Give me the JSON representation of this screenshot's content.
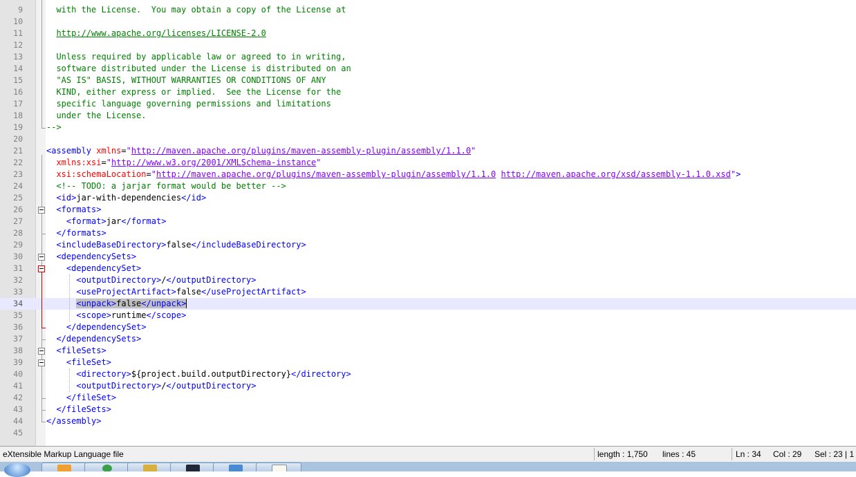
{
  "editor": {
    "current_line": 34,
    "lines": [
      {
        "n": "9",
        "segs": [
          {
            "t": "  with the License.  You may obtain a copy of the License at",
            "c": "cm"
          }
        ]
      },
      {
        "n": "10",
        "segs": []
      },
      {
        "n": "11",
        "segs": [
          {
            "t": "  ",
            "c": "cm"
          },
          {
            "t": "http://www.apache.org/licenses/LICENSE-2.0",
            "c": "cm-link"
          }
        ]
      },
      {
        "n": "12",
        "segs": []
      },
      {
        "n": "13",
        "segs": [
          {
            "t": "  Unless required by applicable law or agreed to in writing,",
            "c": "cm"
          }
        ]
      },
      {
        "n": "14",
        "segs": [
          {
            "t": "  software distributed under the License is distributed on an",
            "c": "cm"
          }
        ]
      },
      {
        "n": "15",
        "segs": [
          {
            "t": "  \"AS IS\" BASIS, WITHOUT WARRANTIES OR CONDITIONS OF ANY",
            "c": "cm"
          }
        ]
      },
      {
        "n": "16",
        "segs": [
          {
            "t": "  KIND, either express or implied.  See the License for the",
            "c": "cm"
          }
        ]
      },
      {
        "n": "17",
        "segs": [
          {
            "t": "  specific language governing permissions and limitations",
            "c": "cm"
          }
        ]
      },
      {
        "n": "18",
        "segs": [
          {
            "t": "  under the License.",
            "c": "cm"
          }
        ]
      },
      {
        "n": "19",
        "segs": [
          {
            "t": "-->",
            "c": "cm"
          }
        ]
      },
      {
        "n": "20",
        "segs": []
      },
      {
        "n": "21",
        "segs": [
          {
            "t": "<assembly ",
            "c": "tag"
          },
          {
            "t": "xmlns",
            "c": "attr"
          },
          {
            "t": "=",
            "c": "txt"
          },
          {
            "t": "\"",
            "c": "str"
          },
          {
            "t": "http://maven.apache.org/plugins/maven-assembly-plugin/assembly/1.1.0",
            "c": "url"
          },
          {
            "t": "\"",
            "c": "str"
          }
        ]
      },
      {
        "n": "22",
        "segs": [
          {
            "t": "  ",
            "c": "txt"
          },
          {
            "t": "xmlns:xsi",
            "c": "attr"
          },
          {
            "t": "=",
            "c": "txt"
          },
          {
            "t": "\"",
            "c": "str"
          },
          {
            "t": "http://www.w3.org/2001/XMLSchema-instance",
            "c": "url"
          },
          {
            "t": "\"",
            "c": "str"
          }
        ]
      },
      {
        "n": "23",
        "segs": [
          {
            "t": "  ",
            "c": "txt"
          },
          {
            "t": "xsi:schemaLocation",
            "c": "attr"
          },
          {
            "t": "=",
            "c": "txt"
          },
          {
            "t": "\"",
            "c": "str"
          },
          {
            "t": "http://maven.apache.org/plugins/maven-assembly-plugin/assembly/1.1.0",
            "c": "url"
          },
          {
            "t": " ",
            "c": "str"
          },
          {
            "t": "http://maven.apache.org/xsd/assembly-1.1.0.xsd",
            "c": "url"
          },
          {
            "t": "\"",
            "c": "str"
          },
          {
            "t": ">",
            "c": "tag"
          }
        ]
      },
      {
        "n": "24",
        "segs": [
          {
            "t": "  <!-- TODO: a jarjar format would be better -->",
            "c": "cm"
          }
        ]
      },
      {
        "n": "25",
        "segs": [
          {
            "t": "  ",
            "c": "txt"
          },
          {
            "t": "<id>",
            "c": "tag"
          },
          {
            "t": "jar-with-dependencies",
            "c": "txt"
          },
          {
            "t": "</id>",
            "c": "tag"
          }
        ]
      },
      {
        "n": "26",
        "segs": [
          {
            "t": "  ",
            "c": "txt"
          },
          {
            "t": "<formats>",
            "c": "tag"
          }
        ]
      },
      {
        "n": "27",
        "segs": [
          {
            "t": "    ",
            "c": "txt"
          },
          {
            "t": "<format>",
            "c": "tag"
          },
          {
            "t": "jar",
            "c": "txt"
          },
          {
            "t": "</format>",
            "c": "tag"
          }
        ]
      },
      {
        "n": "28",
        "segs": [
          {
            "t": "  ",
            "c": "txt"
          },
          {
            "t": "</formats>",
            "c": "tag"
          }
        ]
      },
      {
        "n": "29",
        "segs": [
          {
            "t": "  ",
            "c": "txt"
          },
          {
            "t": "<includeBaseDirectory>",
            "c": "tag"
          },
          {
            "t": "false",
            "c": "txt"
          },
          {
            "t": "</includeBaseDirectory>",
            "c": "tag"
          }
        ]
      },
      {
        "n": "30",
        "segs": [
          {
            "t": "  ",
            "c": "txt"
          },
          {
            "t": "<dependencySets>",
            "c": "tag"
          }
        ]
      },
      {
        "n": "31",
        "segs": [
          {
            "t": "    ",
            "c": "txt"
          },
          {
            "t": "<dependencySet>",
            "c": "tag"
          }
        ]
      },
      {
        "n": "32",
        "segs": [
          {
            "t": "      ",
            "c": "txt"
          },
          {
            "t": "<outputDirectory>",
            "c": "tag"
          },
          {
            "t": "/",
            "c": "txt"
          },
          {
            "t": "</outputDirectory>",
            "c": "tag"
          }
        ]
      },
      {
        "n": "33",
        "segs": [
          {
            "t": "      ",
            "c": "txt"
          },
          {
            "t": "<useProjectArtifact>",
            "c": "tag"
          },
          {
            "t": "false",
            "c": "txt"
          },
          {
            "t": "</useProjectArtifact>",
            "c": "tag"
          }
        ]
      },
      {
        "n": "34",
        "segs": [
          {
            "t": "      ",
            "c": "txt"
          },
          {
            "t": "<unpack>",
            "c": "tag hl"
          },
          {
            "t": "false",
            "c": "txt hl"
          },
          {
            "t": "</unpack>",
            "c": "tag hl caret"
          }
        ]
      },
      {
        "n": "35",
        "segs": [
          {
            "t": "      ",
            "c": "txt"
          },
          {
            "t": "<scope>",
            "c": "tag"
          },
          {
            "t": "runtime",
            "c": "txt"
          },
          {
            "t": "</scope>",
            "c": "tag"
          }
        ]
      },
      {
        "n": "36",
        "segs": [
          {
            "t": "    ",
            "c": "txt"
          },
          {
            "t": "</dependencySet>",
            "c": "tag"
          }
        ]
      },
      {
        "n": "37",
        "segs": [
          {
            "t": "  ",
            "c": "txt"
          },
          {
            "t": "</dependencySets>",
            "c": "tag"
          }
        ]
      },
      {
        "n": "38",
        "segs": [
          {
            "t": "  ",
            "c": "txt"
          },
          {
            "t": "<fileSets>",
            "c": "tag"
          }
        ]
      },
      {
        "n": "39",
        "segs": [
          {
            "t": "    ",
            "c": "txt"
          },
          {
            "t": "<fileSet>",
            "c": "tag"
          }
        ]
      },
      {
        "n": "40",
        "segs": [
          {
            "t": "      ",
            "c": "txt"
          },
          {
            "t": "<directory>",
            "c": "tag"
          },
          {
            "t": "${project.build.outputDirectory}",
            "c": "txt"
          },
          {
            "t": "</directory>",
            "c": "tag"
          }
        ]
      },
      {
        "n": "41",
        "segs": [
          {
            "t": "      ",
            "c": "txt"
          },
          {
            "t": "<outputDirectory>",
            "c": "tag"
          },
          {
            "t": "/",
            "c": "txt"
          },
          {
            "t": "</outputDirectory>",
            "c": "tag"
          }
        ]
      },
      {
        "n": "42",
        "segs": [
          {
            "t": "    ",
            "c": "txt"
          },
          {
            "t": "</fileSet>",
            "c": "tag"
          }
        ]
      },
      {
        "n": "43",
        "segs": [
          {
            "t": "  ",
            "c": "txt"
          },
          {
            "t": "</fileSets>",
            "c": "tag"
          }
        ]
      },
      {
        "n": "44",
        "segs": [
          {
            "t": "</assembly>",
            "c": "tag"
          }
        ]
      },
      {
        "n": "45",
        "segs": []
      }
    ]
  },
  "statusbar": {
    "file_type": "eXtensible Markup Language file",
    "length": "length : 1,750",
    "lines": "lines : 45",
    "ln": "Ln : 34",
    "col": "Col : 29",
    "sel": "Sel : 23 | 1"
  },
  "colors": {
    "tag": "#0000ff",
    "attribute": "#ff0000",
    "attribute_value": "#8000ff",
    "comment": "#008000",
    "current_line": "#e8e8ff",
    "selection": "#c0c0c0"
  },
  "taskbar": {
    "items": [
      "start-orb",
      "firefox-icon",
      "chrome-icon",
      "explorer-icon",
      "terminal-icon",
      "folder-icon",
      "notepad-icon"
    ]
  }
}
